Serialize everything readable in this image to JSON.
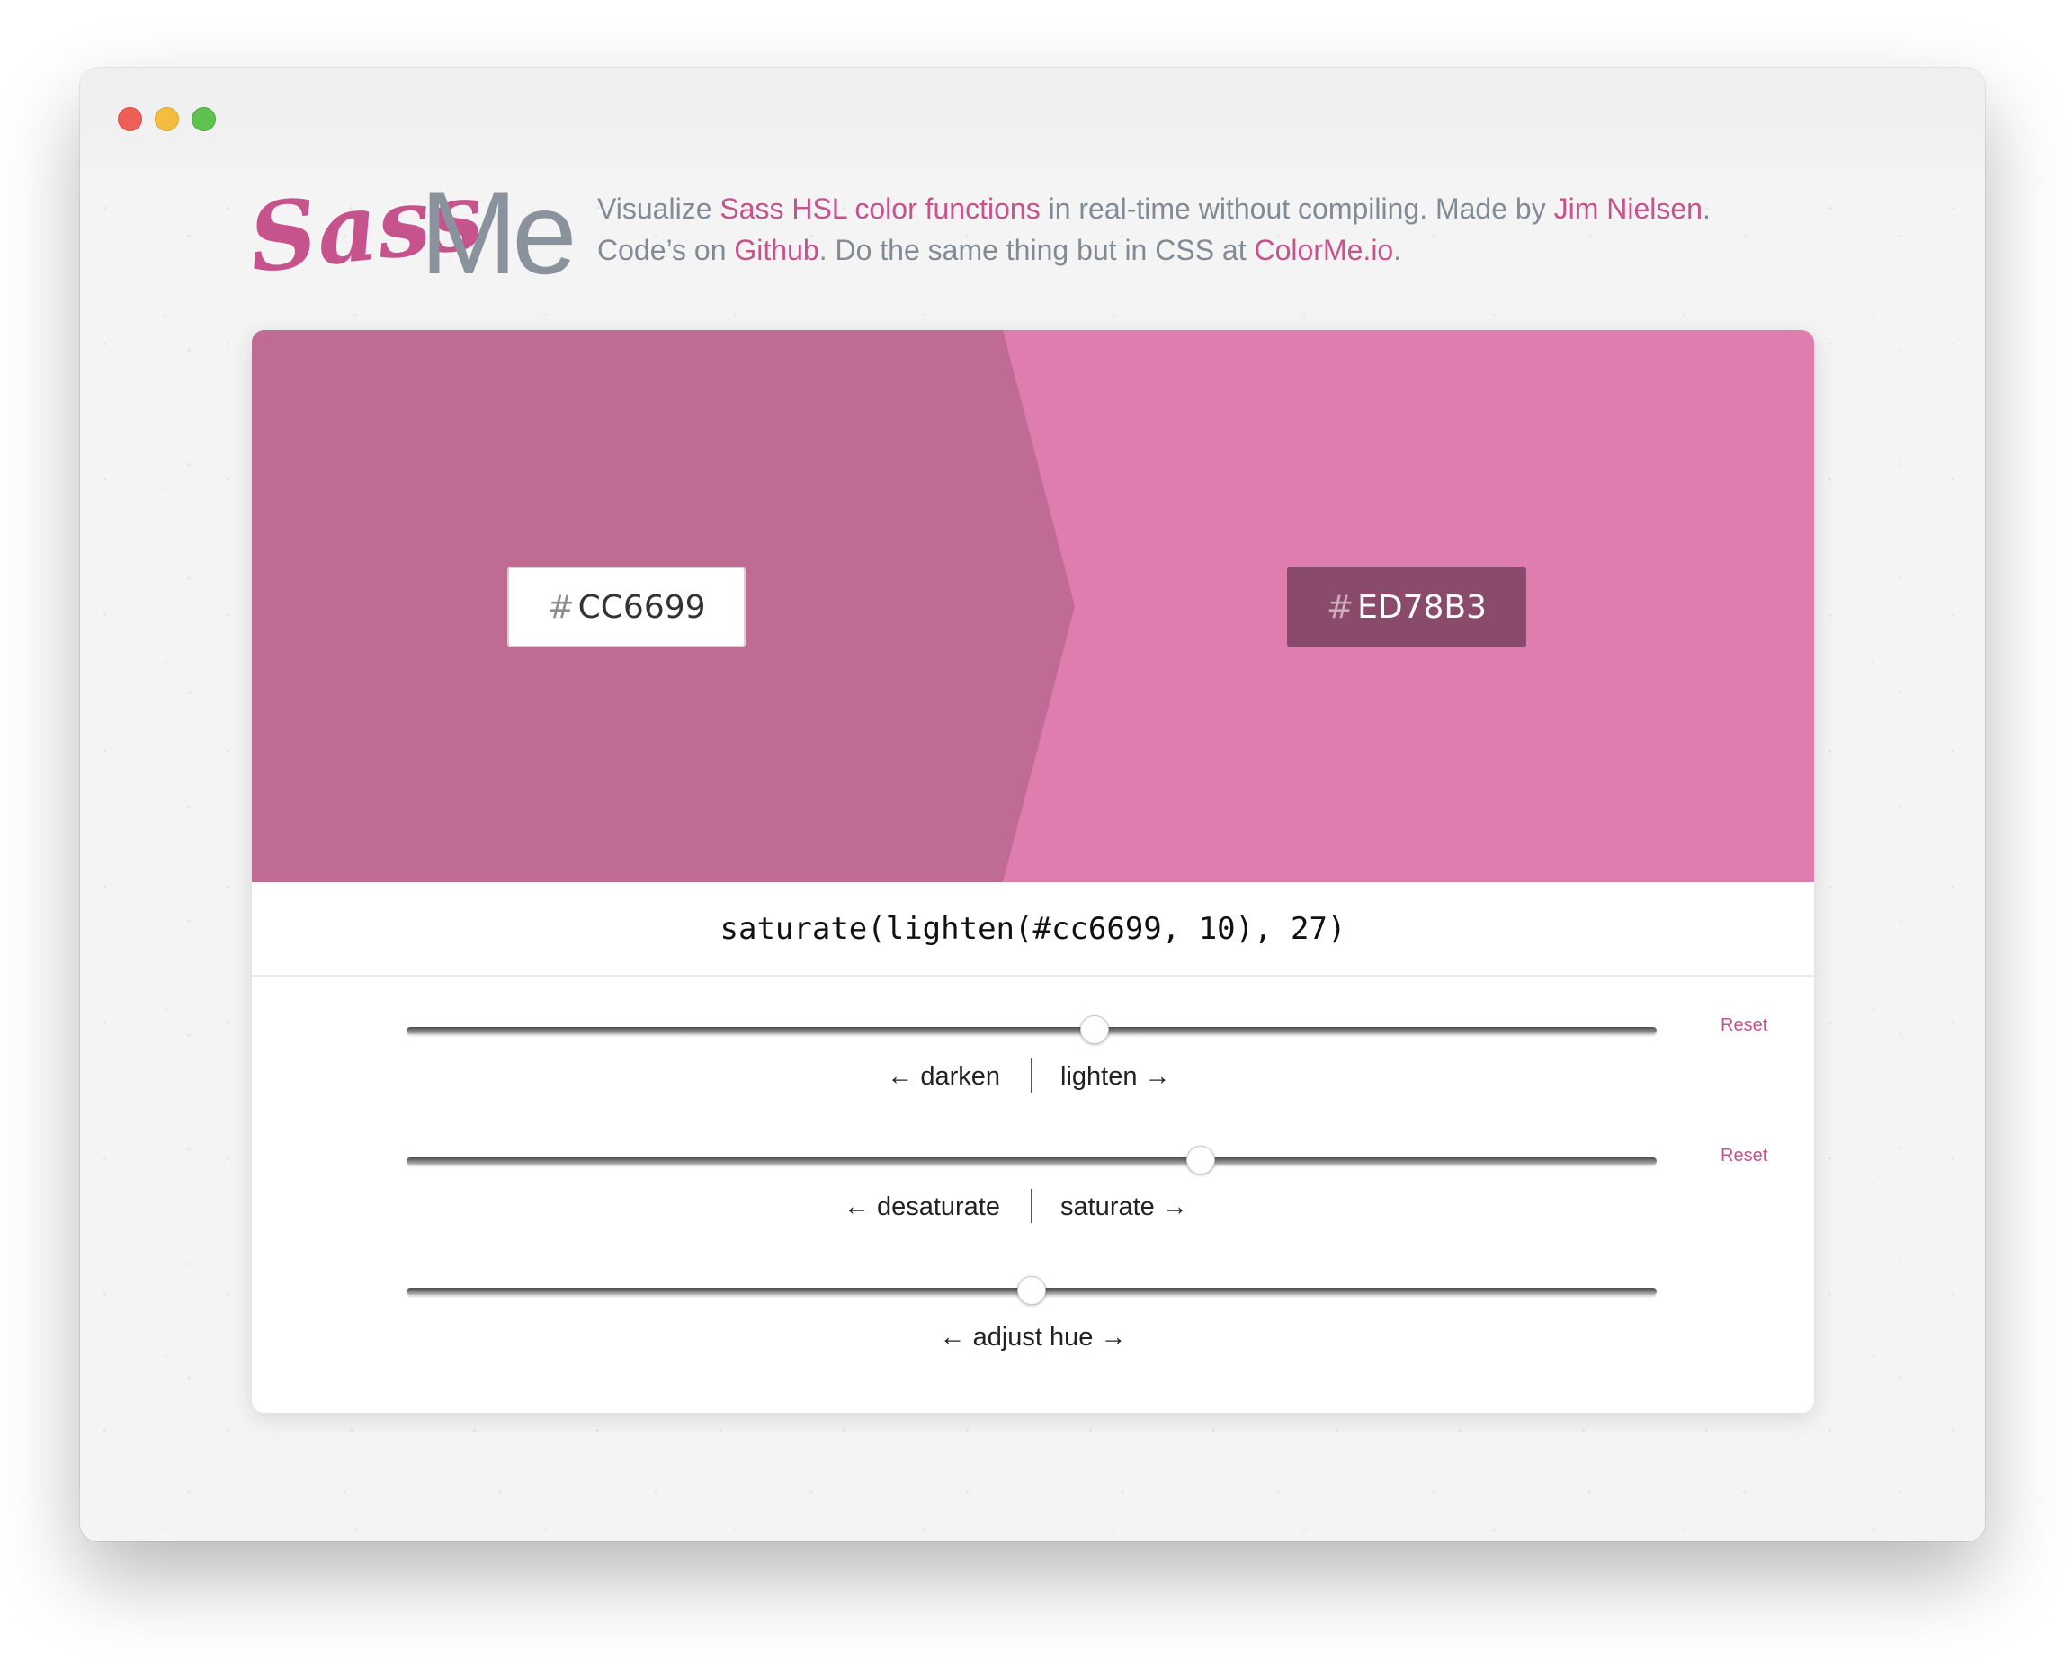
{
  "window": {
    "buttons": [
      "close",
      "minimize",
      "zoom"
    ]
  },
  "logo": {
    "sass": "Sass",
    "me": "Me",
    "color": "#c6538c"
  },
  "header": {
    "t1": "Visualize ",
    "link_sass": "Sass HSL color functions",
    "t2": " in real-time without compiling. Made by ",
    "link_author": "Jim Nielsen",
    "t3": ".",
    "t4": "Code’s on ",
    "link_github": "Github",
    "t5": ". Do the same thing but in CSS at ",
    "link_colorme": "ColorMe.io",
    "t6": "."
  },
  "input_color": {
    "hash": "#",
    "value": "CC6699",
    "swatch": "#bf6b93"
  },
  "output_color": {
    "hash": "#",
    "value": "ED78B3",
    "swatch": "#df7daf",
    "box": "#8a4a6b"
  },
  "formula": "saturate(lighten(#cc6699, 10), 27)",
  "sliders": {
    "lightness": {
      "left_label": "← darken",
      "right_label": "lighten →",
      "reset": "Reset",
      "value": 10,
      "min": -100,
      "max": 100
    },
    "saturation": {
      "left_label": "← desaturate",
      "right_label": "saturate →",
      "reset": "Reset",
      "value": 27,
      "min": -100,
      "max": 100
    },
    "hue": {
      "label": "← adjust hue →",
      "value": 0,
      "min": -180,
      "max": 180
    }
  }
}
